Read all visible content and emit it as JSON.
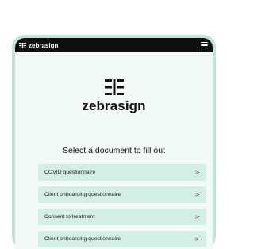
{
  "topbar": {
    "brand": "zebrasign",
    "menu_icon": "hamburger-menu-icon"
  },
  "logo": {
    "wordmark": "zebrasign",
    "icon": "zebrasign-logo-icon"
  },
  "prompt": "Select a document to fill out",
  "documents": [
    {
      "label": "COVID questionnaire",
      "icon": "chevron-right-icon"
    },
    {
      "label": "Client onboarding questionnaire",
      "icon": "chevron-right-icon"
    },
    {
      "label": "Consent to treatment",
      "icon": "chevron-right-icon"
    },
    {
      "label": "Client onboarding questionnaire",
      "icon": "chevron-right-icon"
    }
  ],
  "chevron_glyph": ">",
  "colors": {
    "frame": "#bfe3db",
    "topbar": "#0f0f0f",
    "item_bg": "#d3ede7",
    "content_bg": "#f2faf8"
  }
}
